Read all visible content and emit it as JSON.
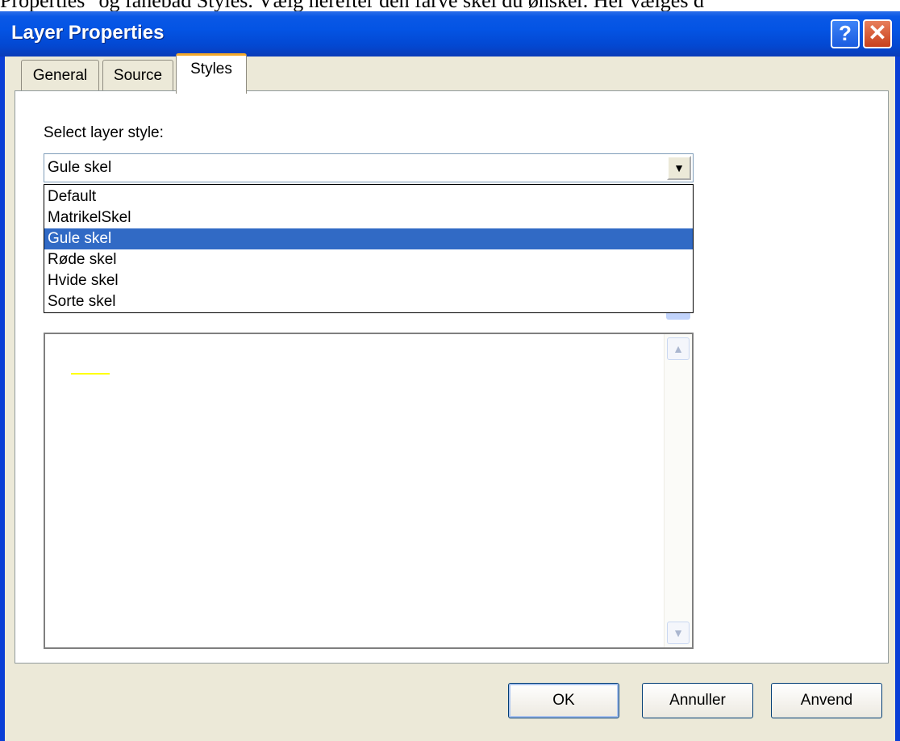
{
  "page_text": "Properties\" og fanebad Styles. Vælg herefter den farve skel du ønsker. Her vælges d",
  "window": {
    "title": "Layer Properties",
    "help_label": "?",
    "close_label": "✕"
  },
  "tabs": [
    {
      "label": "General"
    },
    {
      "label": "Source"
    },
    {
      "label": "Styles",
      "active": true
    }
  ],
  "styles_tab": {
    "select_label": "Select layer style:",
    "selected_style": "Gule skel",
    "options": [
      "Default",
      "MatrikelSkel",
      "Gule skel",
      "Røde skel",
      "Hvide skel",
      "Sorte skel"
    ]
  },
  "preview": {
    "line_color": "#ffff00"
  },
  "buttons": {
    "ok": "OK",
    "cancel": "Annuller",
    "apply": "Anvend"
  },
  "colors": {
    "titlebar": "#0454e4",
    "selection": "#316ac5",
    "dialog_bg": "#ece9d8"
  }
}
